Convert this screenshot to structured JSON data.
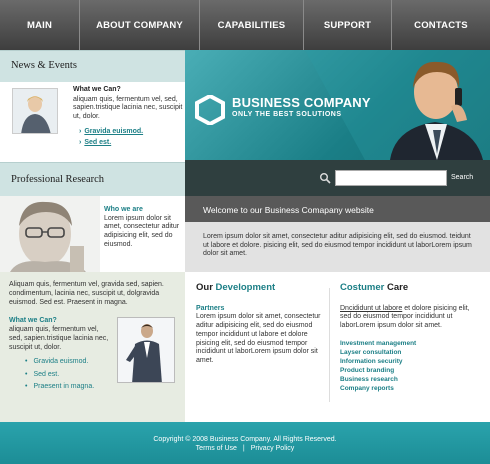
{
  "nav": {
    "items": [
      {
        "label": "MAIN"
      },
      {
        "label": "ABOUT COMPANY"
      },
      {
        "label": "CAPABILITIES"
      },
      {
        "label": "SUPPORT"
      },
      {
        "label": "CONTACTS"
      }
    ]
  },
  "news": {
    "title": "News & Events",
    "heading": "What we Can?",
    "text": "aliquam quis, fermentum vel, sed, sapien.tristique lacinia nec, suscipit ut, dolor.",
    "links": [
      "Gravida euismod.",
      "Sed est."
    ]
  },
  "hero": {
    "brand": "BUSINESS COMPANY",
    "tagline": "ONLY THE BEST SOLUTIONS"
  },
  "search": {
    "value": "",
    "button": "Search"
  },
  "professional": {
    "title": "Professional Research",
    "heading": "Who we are",
    "text": "Lorem ipsum dolor sit amet, consectetur aditur adipisicing elit, sed do eiusmod."
  },
  "left_bottom": {
    "intro": "Aliquam quis, fermentum vel, gravida sed, sapien. condimentum, lacinia nec, suscipit ut, dolgravida euismod. Sed est. Praesent in magna.",
    "heading": "What we Can?",
    "text": "aliquam quis, fermentum vel, sed, sapien.tristique lacinia nec, suscipit ut, dolor.",
    "bullets": [
      "Gravida euismod.",
      "Sed est.",
      "Praesent in magna."
    ]
  },
  "welcome": {
    "title": "Welcome to our Business Comapany website",
    "body": "Lorem ipsum dolor sit amet, consectetur aditur adipisicing elit, sed do eiusmod. teidunt ut labore et dolore. pisicing elit, sed do eiusmod tempor incididunt ut laborLorem ipsum dolor sit amet."
  },
  "development": {
    "title_a": "Our",
    "title_b": "Development",
    "subtitle": "Partners",
    "text": "Lorem ipsum dolor sit amet, consectetur aditur adipisicing elit, sed do eiusmod tempor incididunt ut labore et dolore pisicing elit, sed do eiusmod tempor incididunt ut laborLorem ipsum dolor sit amet."
  },
  "care": {
    "title_a": "Costumer",
    "title_b": "Care",
    "lead_link": "Dncididunt ut labore",
    "text": " et dolore pisicing elit, sed do eiusmod tempor incididunt ut laborLorem ipsum dolor sit amet.",
    "links": [
      "Investment management",
      "Layser consultation",
      "Information security",
      "Product branding",
      "Business research",
      "Company reports"
    ]
  },
  "footer": {
    "copyright": "Copyright © 2008 Business Company. All Rights Reserved.",
    "terms": "Terms of Use",
    "separator": "|",
    "privacy": "Privacy Policy"
  },
  "colors": {
    "accent": "#1c7f86",
    "nav": "#4a4a4a",
    "footer": "#22979f"
  }
}
